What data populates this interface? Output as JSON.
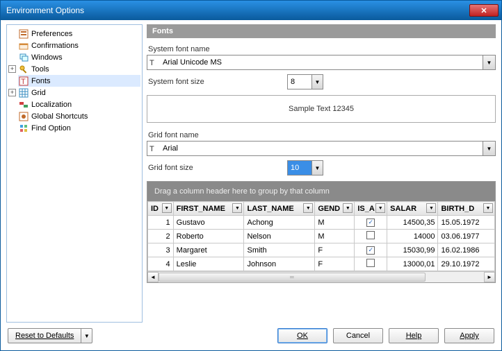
{
  "window": {
    "title": "Environment Options"
  },
  "tree": {
    "items": [
      {
        "label": "Preferences"
      },
      {
        "label": "Confirmations"
      },
      {
        "label": "Windows"
      },
      {
        "label": "Tools"
      },
      {
        "label": "Fonts"
      },
      {
        "label": "Grid"
      },
      {
        "label": "Localization"
      },
      {
        "label": "Global Shortcuts"
      },
      {
        "label": "Find Option"
      }
    ]
  },
  "panel": {
    "title": "Fonts",
    "sysFontNameLabel": "System font name",
    "sysFontName": "Arial Unicode MS",
    "sysFontSizeLabel": "System font size",
    "sysFontSize": "8",
    "sampleText": "Sample Text 12345",
    "gridFontNameLabel": "Grid font name",
    "gridFontName": "Arial",
    "gridFontSizeLabel": "Grid font size",
    "gridFontSize": "10"
  },
  "grid": {
    "groupHint": "Drag a column header here to group by that column",
    "columns": [
      "ID",
      "FIRST_NAME",
      "LAST_NAME",
      "GEND",
      "IS_A",
      "SALAR",
      "BIRTH_D"
    ],
    "rows": [
      {
        "id": "1",
        "first": "Gustavo",
        "last": "Achong",
        "gend": "M",
        "is_a": true,
        "salary": "14500,35",
        "birth": "15.05.1972"
      },
      {
        "id": "2",
        "first": "Roberto",
        "last": "Nelson",
        "gend": "M",
        "is_a": false,
        "salary": "14000",
        "birth": "03.06.1977"
      },
      {
        "id": "3",
        "first": "Margaret",
        "last": "Smith",
        "gend": "F",
        "is_a": true,
        "salary": "15030,99",
        "birth": "16.02.1986"
      },
      {
        "id": "4",
        "first": "Leslie",
        "last": "Johnson",
        "gend": "F",
        "is_a": false,
        "salary": "13000,01",
        "birth": "29.10.1972"
      }
    ]
  },
  "footer": {
    "reset": "Reset to Defaults",
    "ok": "OK",
    "cancel": "Cancel",
    "help": "Help",
    "apply": "Apply"
  }
}
